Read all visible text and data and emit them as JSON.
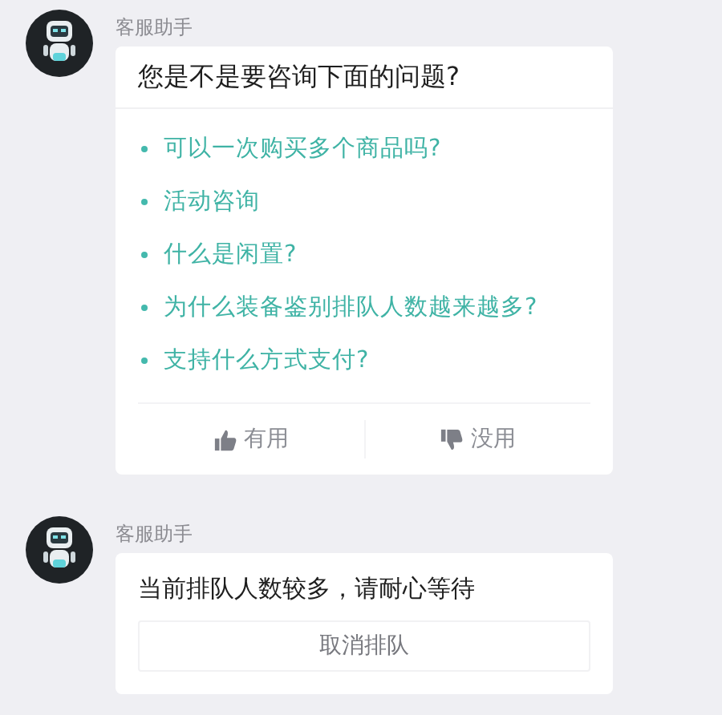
{
  "messages": [
    {
      "kind": "faq",
      "sender": "客服助手",
      "title": "您是不是要咨询下面的问题?",
      "questions": [
        "可以一次购买多个商品吗?",
        "活动咨询",
        "什么是闲置?",
        "为什么装备鉴别排队人数越来越多?",
        "支持什么方式支付?"
      ],
      "feedback": [
        {
          "kind": "up",
          "label": "有用"
        },
        {
          "kind": "down",
          "label": "没用"
        }
      ]
    },
    {
      "kind": "queue",
      "sender": "客服助手",
      "text": "当前排队人数较多，请耐心等待",
      "button": "取消排队"
    }
  ]
}
